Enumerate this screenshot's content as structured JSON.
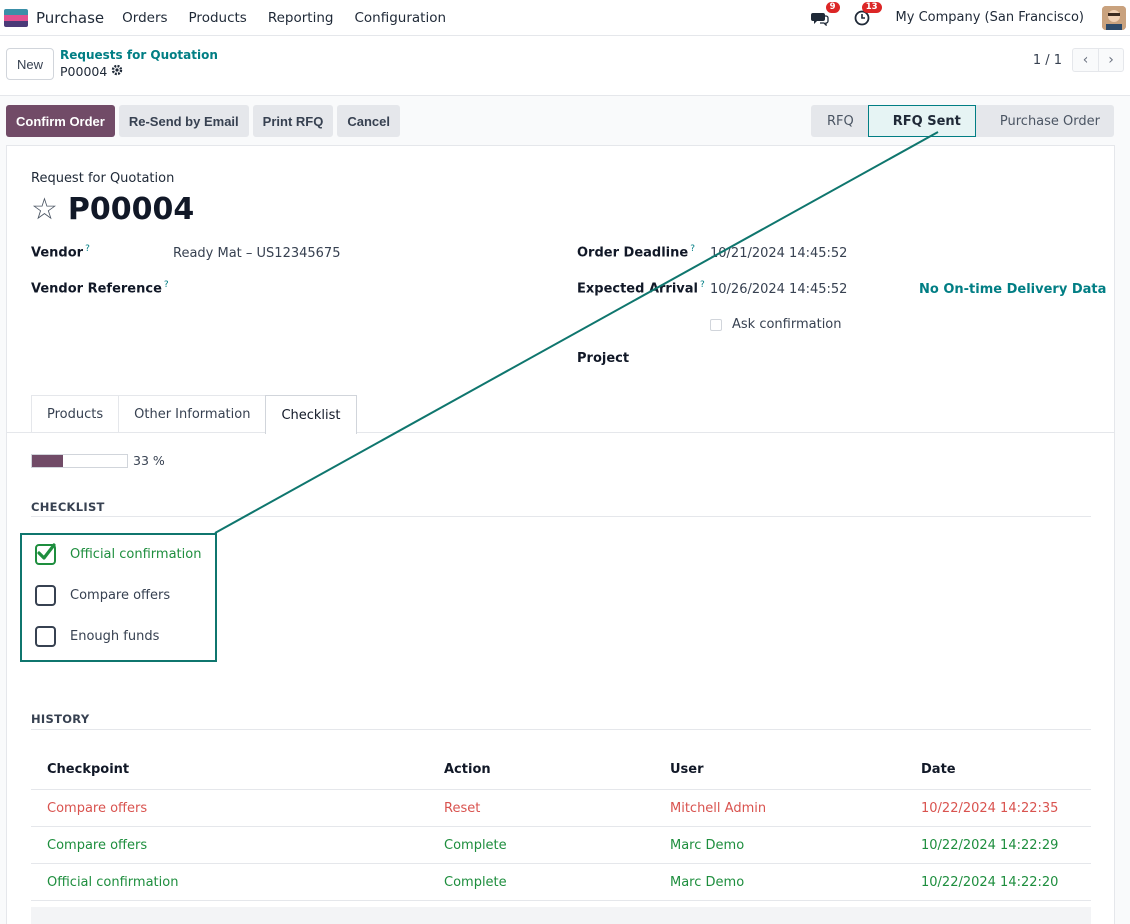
{
  "navbar": {
    "app_name": "Purchase",
    "menu": [
      "Orders",
      "Products",
      "Reporting",
      "Configuration"
    ],
    "messages_count": "9",
    "activities_count": "13",
    "company": "My Company (San Francisco)"
  },
  "control": {
    "new_label": "New",
    "breadcrumb_parent": "Requests for Quotation",
    "breadcrumb_current": "P00004",
    "pager_value": "1 / 1"
  },
  "actions": {
    "confirm": "Confirm Order",
    "resend": "Re-Send by Email",
    "print": "Print RFQ",
    "cancel": "Cancel"
  },
  "stages": {
    "rfq": "RFQ",
    "rfq_sent": "RFQ Sent",
    "purchase_order": "Purchase Order",
    "active": "RFQ Sent"
  },
  "form": {
    "label": "Request for Quotation",
    "title": "P00004",
    "vendor_label": "Vendor",
    "vendor_value": "Ready Mat – US12345675",
    "vendor_ref_label": "Vendor Reference",
    "order_deadline_label": "Order Deadline",
    "order_deadline_value": "10/21/2024 14:45:52",
    "expected_arrival_label": "Expected Arrival",
    "expected_arrival_value": "10/26/2024 14:45:52",
    "ontime_label": "No On-time Delivery Data",
    "ask_confirmation_label": "Ask confirmation",
    "project_label": "Project",
    "help_marker": "?"
  },
  "tabs": [
    "Products",
    "Other Information",
    "Checklist"
  ],
  "active_tab": "Checklist",
  "checklist": {
    "progress_percent": 33,
    "progress_text": "33 %",
    "section_title": "CHECKLIST",
    "items": [
      {
        "label": "Official confirmation",
        "checked": true
      },
      {
        "label": "Compare offers",
        "checked": false
      },
      {
        "label": "Enough funds",
        "checked": false
      }
    ]
  },
  "history": {
    "section_title": "HISTORY",
    "columns": [
      "Checkpoint",
      "Action",
      "User",
      "Date"
    ],
    "rows": [
      {
        "checkpoint": "Compare offers",
        "action": "Reset",
        "user": "Mitchell Admin",
        "date": "10/22/2024 14:22:35",
        "status": "reset"
      },
      {
        "checkpoint": "Compare offers",
        "action": "Complete",
        "user": "Marc Demo",
        "date": "10/22/2024 14:22:29",
        "status": "complete"
      },
      {
        "checkpoint": "Official confirmation",
        "action": "Complete",
        "user": "Marc Demo",
        "date": "10/22/2024 14:22:20",
        "status": "complete"
      }
    ]
  },
  "colors": {
    "brand": "#714b67",
    "accent": "#017e84",
    "success": "#1e8e3e",
    "danger": "#d9534f",
    "annotation": "#0f766e"
  }
}
